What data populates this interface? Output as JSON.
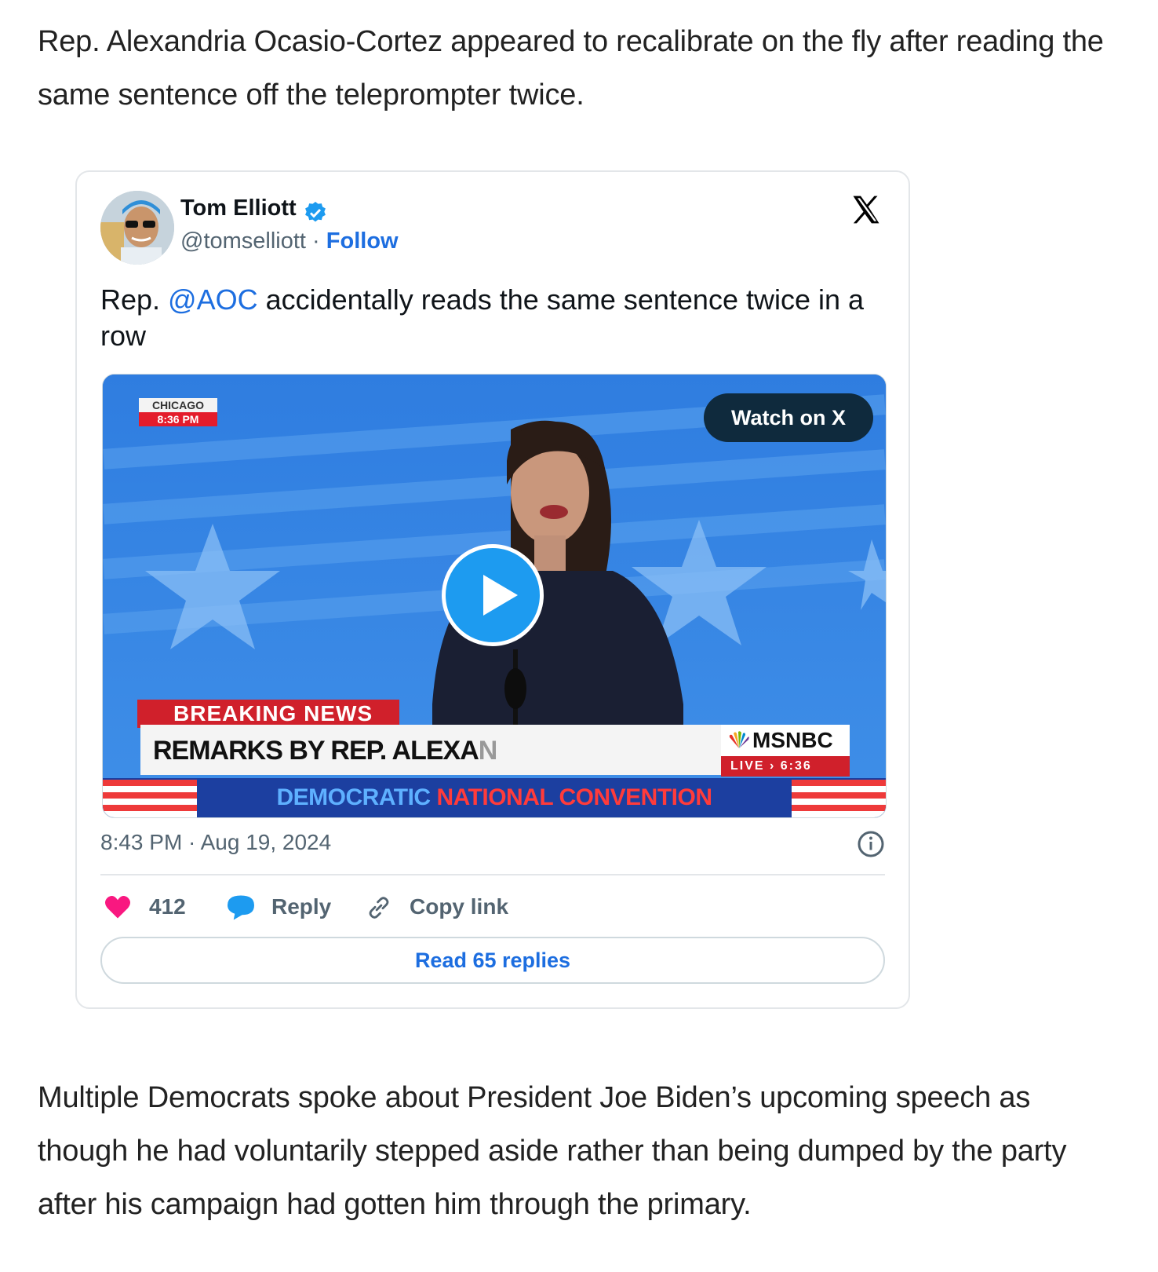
{
  "article": {
    "paragraph_1": "Rep. Alexandria Ocasio-Cortez appeared to recalibrate on the fly after reading the same sentence off the teleprompter twice.",
    "paragraph_2": "Multiple Democrats spoke about President Joe Biden’s upcoming speech as though he had voluntarily stepped aside rather than being dumped by the party after his campaign had gotten him through the primary."
  },
  "tweet": {
    "author_name": "Tom Elliott",
    "handle": "@tomselliott",
    "separator": "·",
    "follow_label": "Follow",
    "text_prefix": "Rep. ",
    "mention": "@AOC",
    "text_suffix": " accidentally reads the same sentence twice in a row",
    "timestamp": "8:43 PM · Aug 19, 2024",
    "likes_count": "412",
    "reply_label": "Reply",
    "copy_link_label": "Copy link",
    "read_replies_label": "Read 65 replies",
    "icons": [
      "verified-badge-icon",
      "x-logo-icon",
      "info-icon",
      "heart-icon",
      "reply-bubble-icon",
      "link-icon",
      "play-icon"
    ],
    "colors": {
      "link_blue": "#1d6ee0",
      "heart_pink": "#f91880",
      "reply_blue": "#1d9bf0"
    }
  },
  "video": {
    "watch_label": "Watch on X",
    "chicago_city": "CHICAGO",
    "chicago_time": "8:36 PM",
    "breaking_label": "BREAKING NEWS",
    "lower_third_main": "REMARKS BY REP. ALEXA",
    "lower_third_fade": "N",
    "network": "MSNBC",
    "live_label": "LIVE › 6:36",
    "convention_part1": "DEMOCRATIC",
    "convention_part2": "NATIONAL CONVENTION"
  }
}
